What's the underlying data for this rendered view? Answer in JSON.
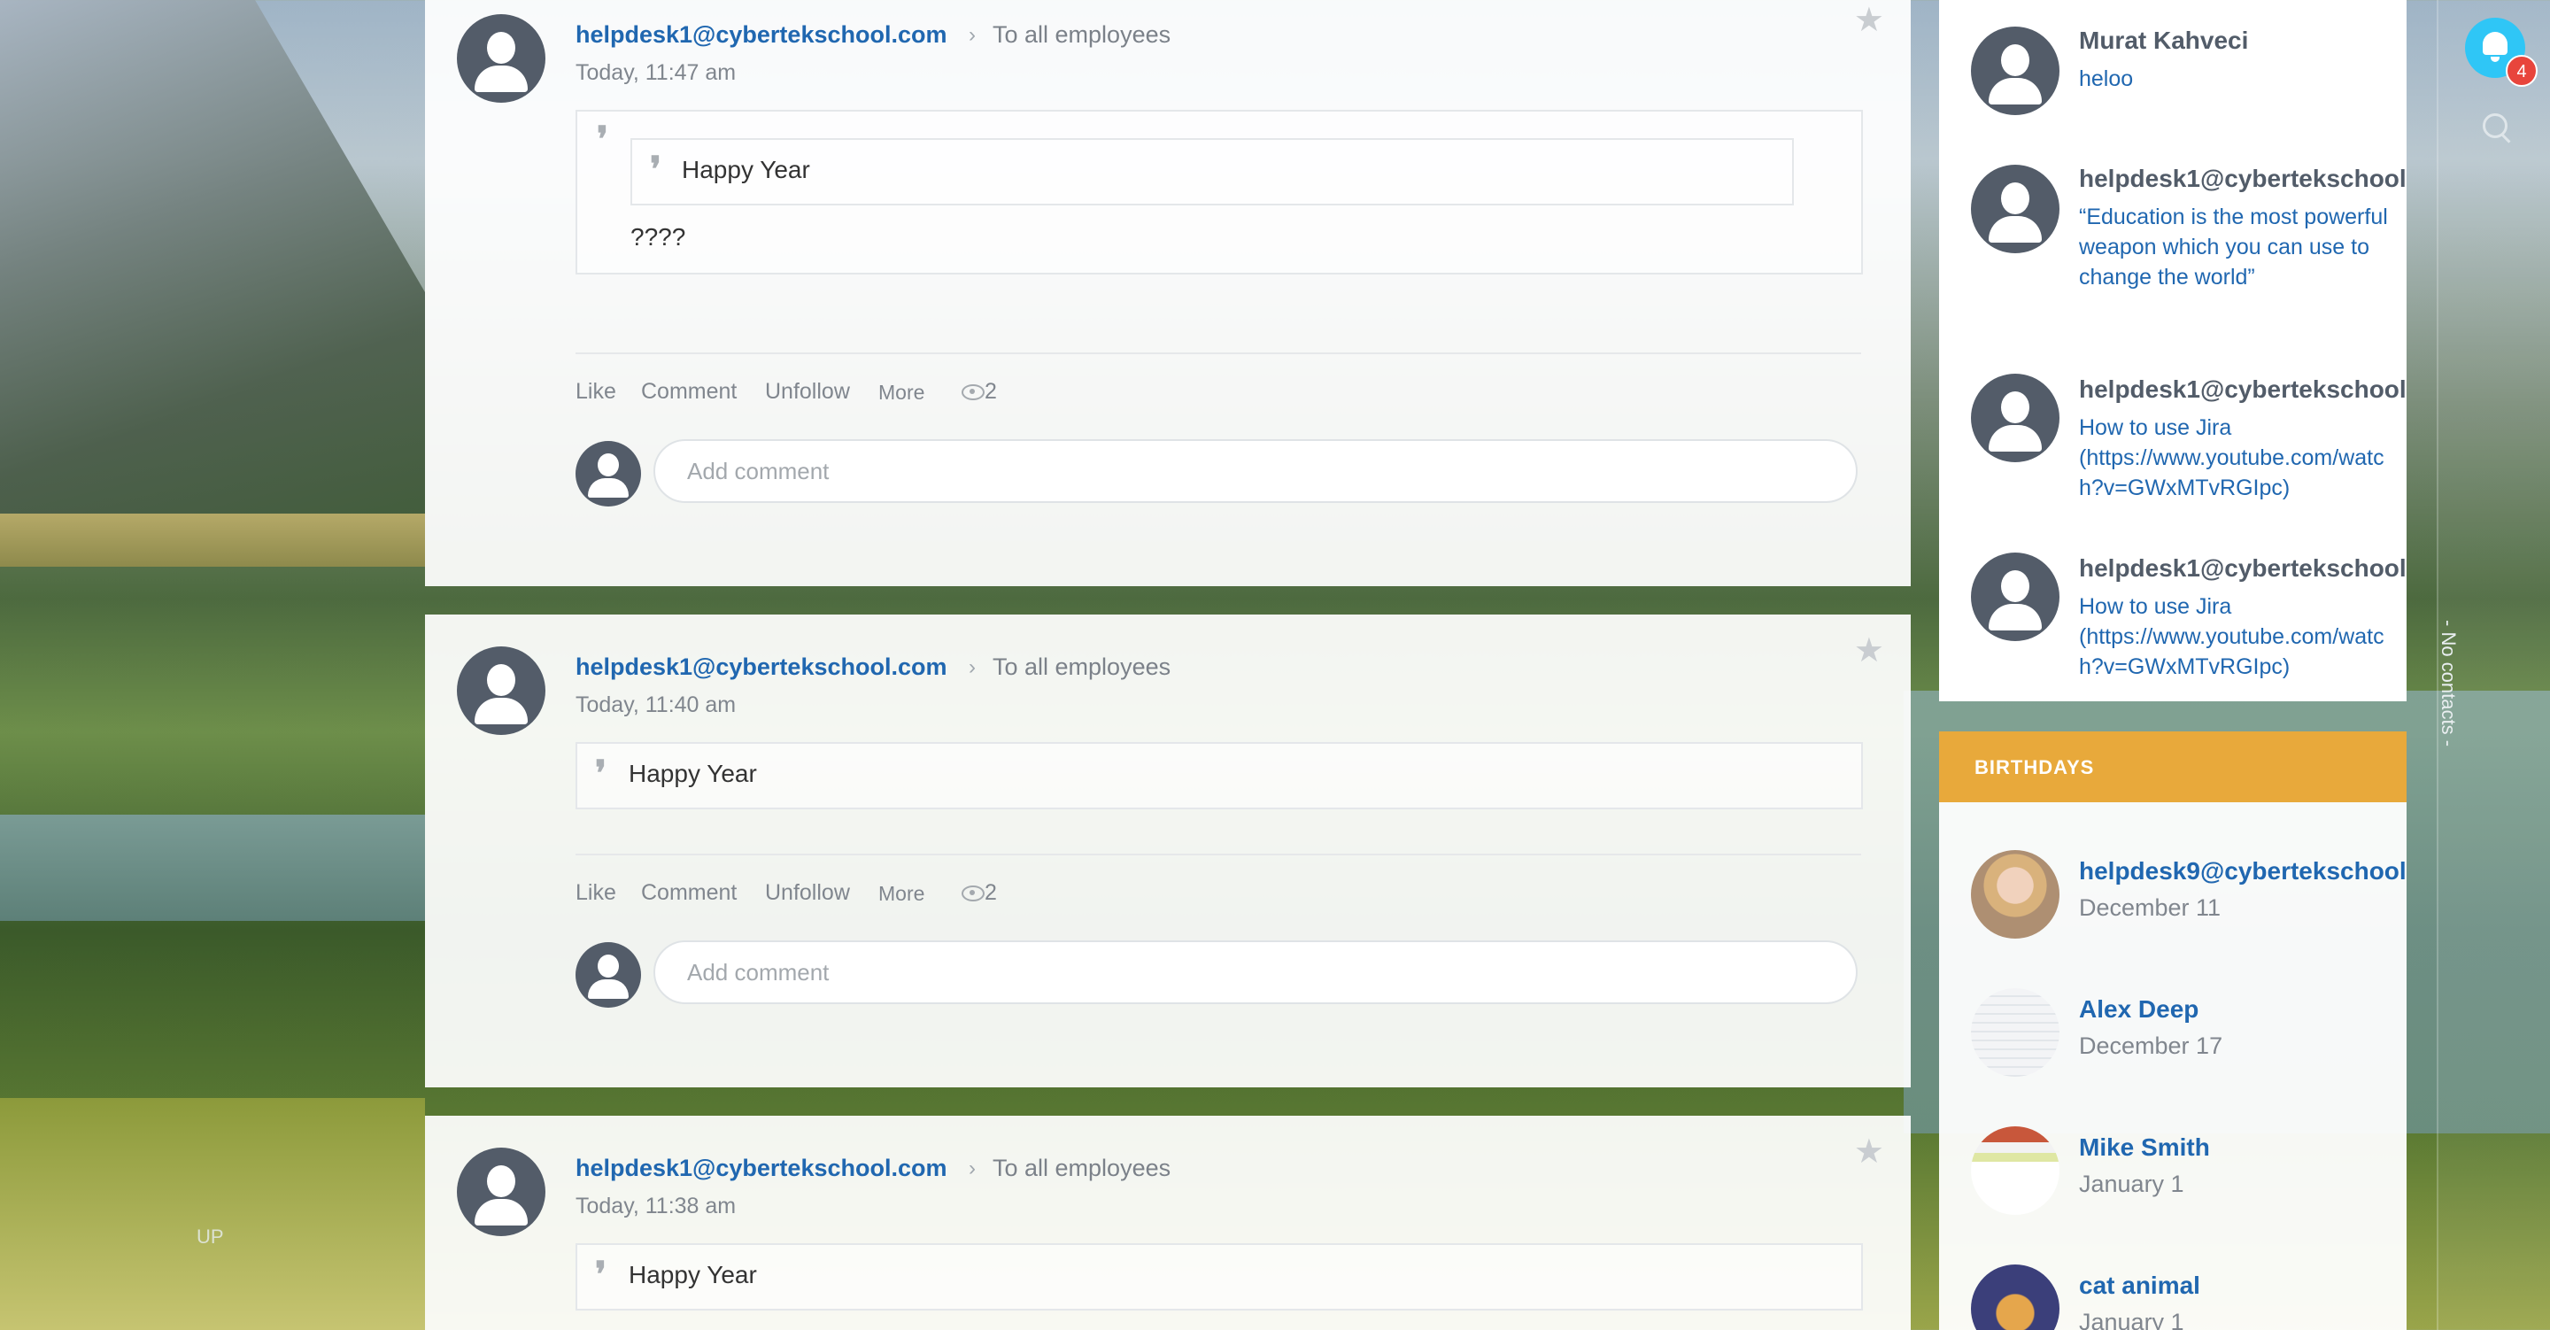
{
  "background": {
    "up_label": "UP"
  },
  "posts": [
    {
      "author": "helpdesk1@cybertekschool.com",
      "destination": "To all employees",
      "time": "Today, 11:47 am",
      "quoted": "Happy Year",
      "body": "????",
      "actions": {
        "like": "Like",
        "comment": "Comment",
        "unfollow": "Unfollow",
        "more": "More",
        "views": "2"
      },
      "comment_placeholder": "Add comment"
    },
    {
      "author": "helpdesk1@cybertekschool.com",
      "destination": "To all employees",
      "time": "Today, 11:40 am",
      "quoted": "Happy Year",
      "actions": {
        "like": "Like",
        "comment": "Comment",
        "unfollow": "Unfollow",
        "more": "More",
        "views": "2"
      },
      "comment_placeholder": "Add comment"
    },
    {
      "author": "helpdesk1@cybertekschool.com",
      "destination": "To all employees",
      "time": "Today, 11:38 am",
      "quoted": "Happy Year"
    }
  ],
  "announcements": [
    {
      "name": "Murat Kahveci",
      "text": "heloo"
    },
    {
      "name": "helpdesk1@cybertekschool.",
      "text": "“Education is the most powerful weapon which you can use to change the world”"
    },
    {
      "name": "helpdesk1@cybertekschool.",
      "text": "How to use Jira (https://www.youtube.com/watch?v=GWxMTvRGIpc)"
    },
    {
      "name": "helpdesk1@cybertekschool.",
      "text": "How to use Jira (https://www.youtube.com/watch?v=GWxMTvRGIpc)"
    }
  ],
  "birthdays": {
    "title": "BIRTHDAYS",
    "items": [
      {
        "name": "helpdesk9@cybertekschool.",
        "date": "December 11"
      },
      {
        "name": "Alex Deep",
        "date": "December 17"
      },
      {
        "name": "Mike Smith",
        "date": "January 1"
      },
      {
        "name": "cat animal",
        "date": "January 1"
      }
    ]
  },
  "side_strip": {
    "notification_count": "4",
    "no_contacts": "- No contacts -"
  },
  "colors": {
    "accent": "#2067b0",
    "birthday_header": "#e8a93b",
    "bell": "#2fc6f6",
    "badge": "#e8453c"
  }
}
